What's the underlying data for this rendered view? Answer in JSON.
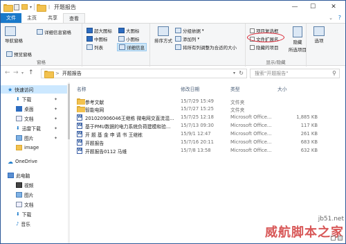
{
  "window": {
    "title": "开题报告"
  },
  "title_buttons": {
    "minimize": "—",
    "maximize": "☐",
    "close": "✕"
  },
  "tabs": [
    {
      "label": "文件"
    },
    {
      "label": "主页"
    },
    {
      "label": "共享"
    },
    {
      "label": "查看"
    }
  ],
  "help_icon": "?",
  "ribbon": {
    "panes": {
      "title": "窗格",
      "nav_pane": "导航窗格",
      "preview_pane": "预览窗格",
      "details_pane": "详细信息窗格"
    },
    "layout": {
      "extra_large": "超大图标",
      "large": "大图标",
      "medium": "中图标",
      "small": "小图标",
      "list": "列表",
      "details": "详细信息"
    },
    "current_view": {
      "sort": "排序方式",
      "group_by": "分组依据",
      "add_columns": "添加列",
      "size_columns": "将所有列调整为合适的大小"
    },
    "show_hide": {
      "title": "显示/隐藏",
      "item_checkboxes": "项目复选框",
      "file_extensions": "文件扩展名",
      "hidden_items": "隐藏的项目",
      "hide_selected": "隐藏",
      "hide_selected_2": "所选项目"
    },
    "options": "选项"
  },
  "address": {
    "separator": ">",
    "current": "开题报告",
    "search_placeholder": "搜索\"开题报告\""
  },
  "nav": {
    "quick_access": "快速访问",
    "items": [
      {
        "label": "下载"
      },
      {
        "label": "桌面"
      },
      {
        "label": "文档"
      },
      {
        "label": "迅雷下载"
      },
      {
        "label": "图片"
      },
      {
        "label": "image"
      }
    ],
    "onedrive": "OneDrive",
    "this_pc": "此电脑",
    "pc_items": [
      {
        "label": "视频"
      },
      {
        "label": "图片"
      },
      {
        "label": "文档"
      },
      {
        "label": "下载"
      },
      {
        "label": "音乐"
      }
    ]
  },
  "columns": {
    "name": "名称",
    "date": "修改日期",
    "type": "类型",
    "size": "大小"
  },
  "files": [
    {
      "name": "参考文献",
      "date": "15/7/29 15:49",
      "type": "文件夹",
      "size": "",
      "kind": "folder"
    },
    {
      "name": "智能电网",
      "date": "15/7/27 15:25",
      "type": "文件夹",
      "size": "",
      "kind": "folder"
    },
    {
      "name": "201020906046王继栋 微电网交直流混...",
      "date": "15/7/25 12:18",
      "type": "Microsoft Office...",
      "size": "1,885 KB",
      "kind": "doc"
    },
    {
      "name": "基于PMU数据的电力系统负荷建模和验...",
      "date": "15/7/13 09:30",
      "type": "Microsoft Office...",
      "size": "117 KB",
      "kind": "doc"
    },
    {
      "name": "开 题 基 金 申 请 书  王继栋",
      "date": "15/9/1 12:47",
      "type": "Microsoft Office...",
      "size": "261 KB",
      "kind": "doc"
    },
    {
      "name": "开题报告",
      "date": "15/7/16 20:11",
      "type": "Microsoft Office...",
      "size": "683 KB",
      "kind": "doc"
    },
    {
      "name": "开题报告0112 马维",
      "date": "15/7/8 13:58",
      "type": "Microsoft Office...",
      "size": "632 KB",
      "kind": "doc"
    }
  ],
  "watermark": {
    "line1": "jb51.net",
    "line2": "威航脚本之家"
  }
}
